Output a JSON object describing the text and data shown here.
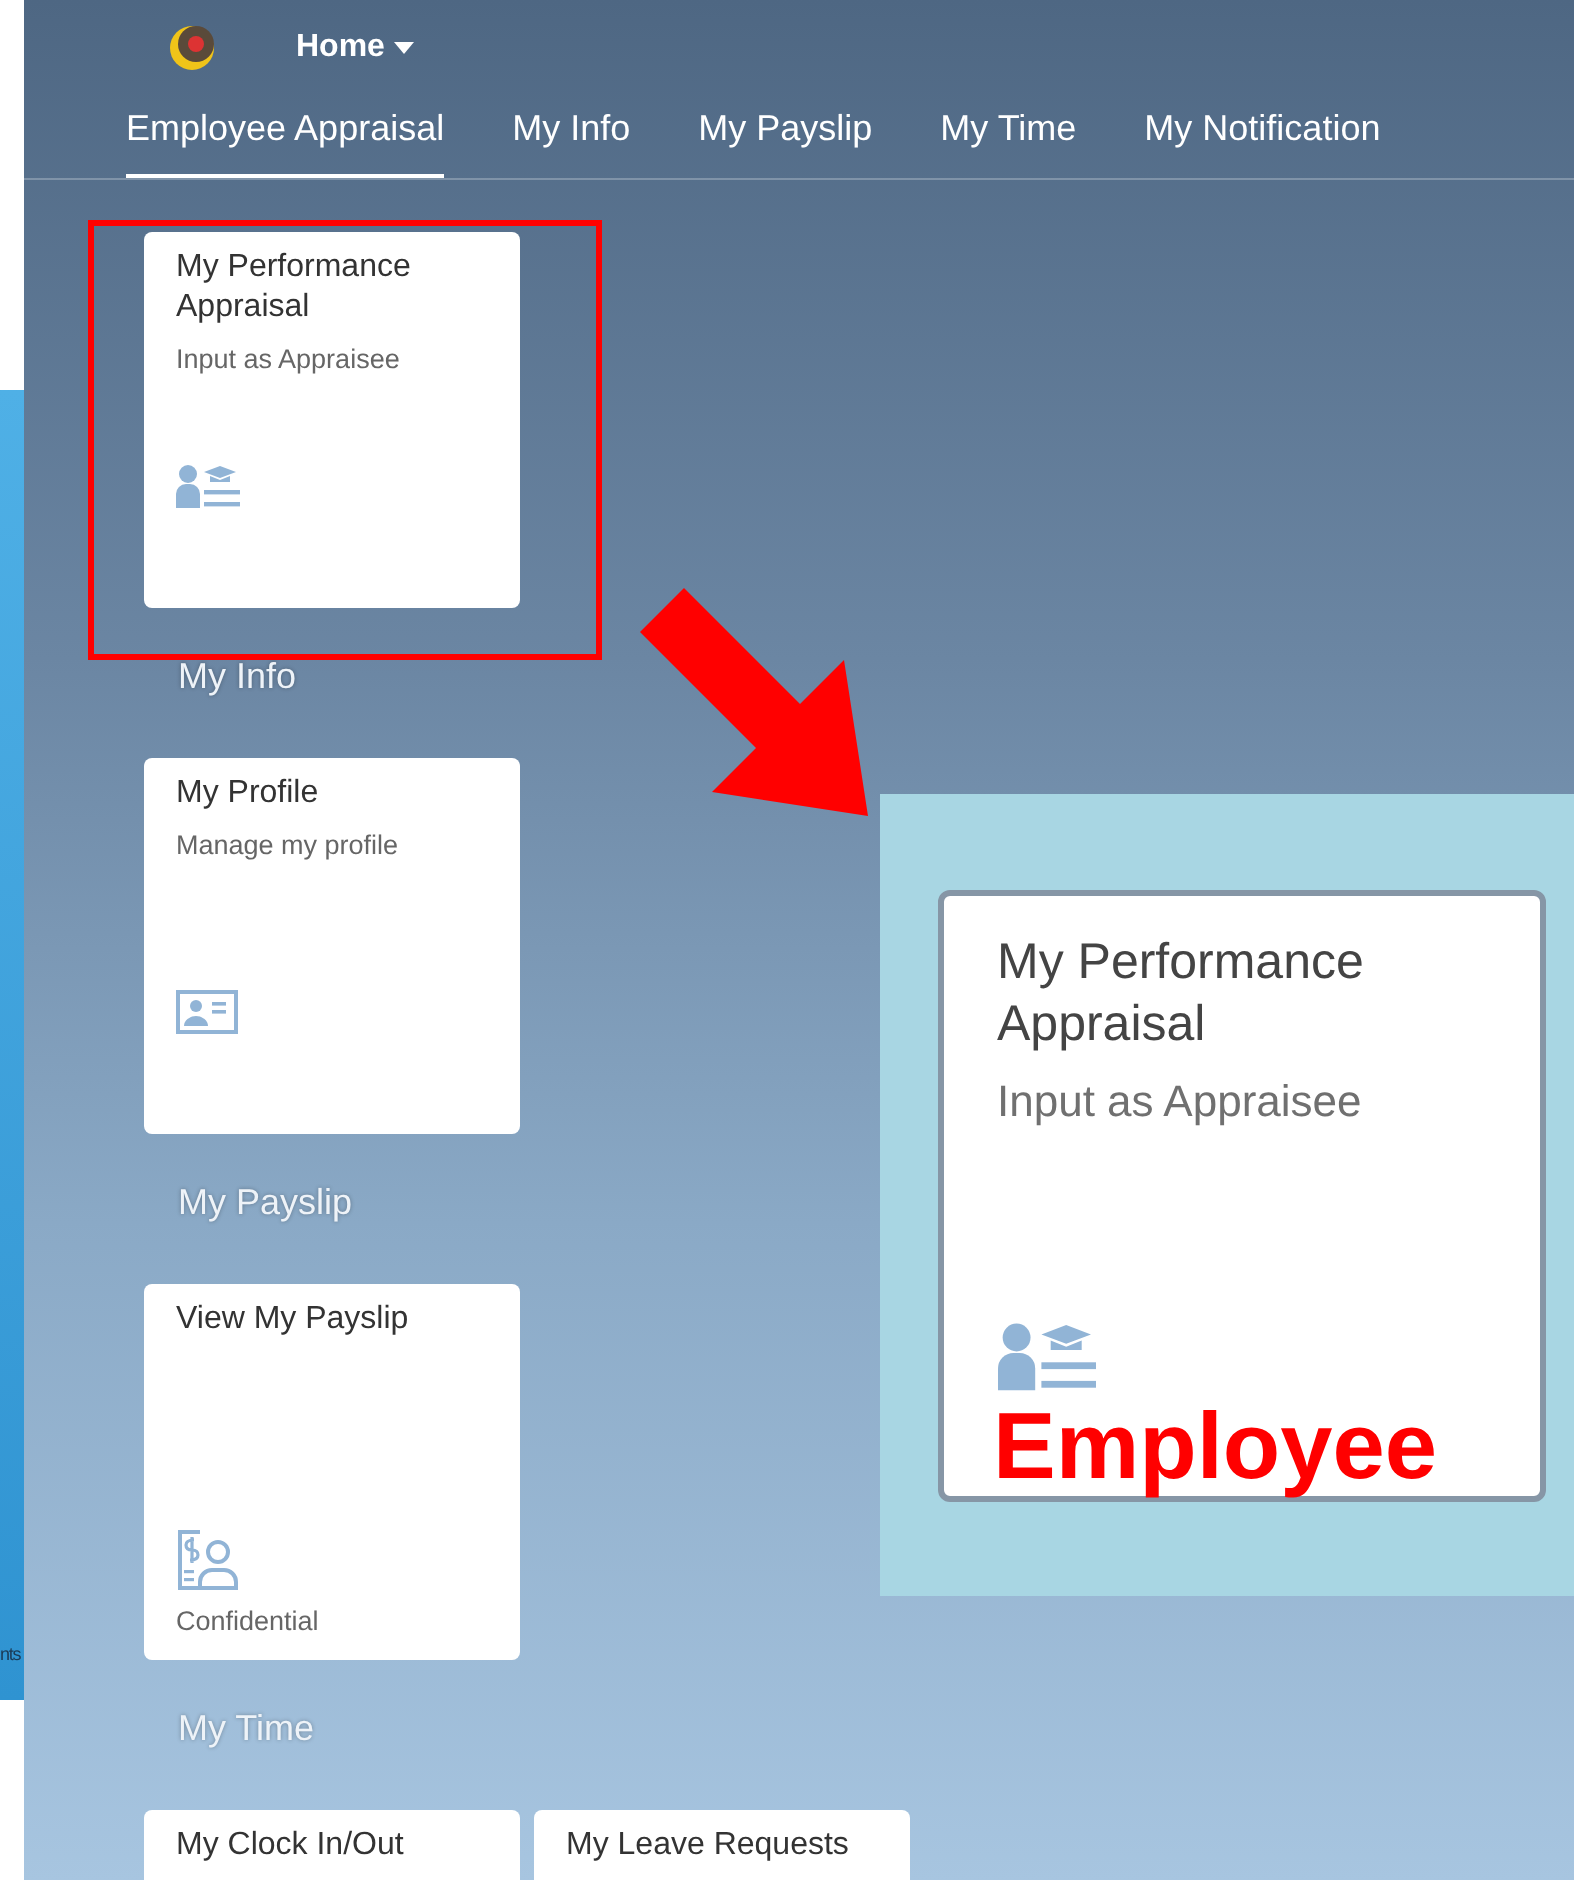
{
  "background_window": {
    "text": "nts"
  },
  "header": {
    "home_label": "Home"
  },
  "tabs": [
    {
      "label": "Employee Appraisal",
      "selected": true
    },
    {
      "label": "My Info",
      "selected": false
    },
    {
      "label": "My Payslip",
      "selected": false
    },
    {
      "label": "My Time",
      "selected": false
    },
    {
      "label": "My Notification",
      "selected": false
    }
  ],
  "groups": [
    {
      "tiles": [
        {
          "kind": "appraisal",
          "title": "My Performance Appraisal",
          "subtitle": "Input as Appraisee"
        }
      ]
    },
    {
      "title": "My Info",
      "tiles": [
        {
          "kind": "profile",
          "title": "My Profile",
          "subtitle": "Manage my profile"
        }
      ]
    },
    {
      "title": "My Payslip",
      "tiles": [
        {
          "kind": "payslip",
          "title": "View My Payslip",
          "footer": "Confidential"
        }
      ]
    },
    {
      "title": "My Time",
      "tiles": [
        {
          "kind": "plain",
          "title": "My Clock In/Out"
        },
        {
          "kind": "plain",
          "title": "My Leave Requests"
        }
      ]
    }
  ],
  "callout": {
    "tile": {
      "kind": "appraisal",
      "title": "My Performance Appraisal",
      "subtitle": "Input as Appraisee"
    },
    "label": "Employee"
  }
}
